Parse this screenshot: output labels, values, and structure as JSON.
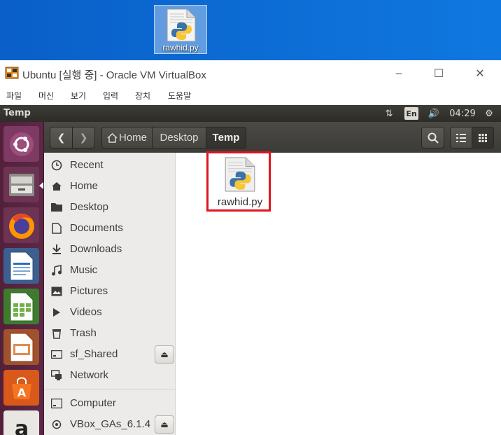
{
  "desktop": {
    "file_label": "rawhid.py",
    "file_icon": "python-file-icon"
  },
  "vbox": {
    "title": "Ubuntu [실행 중] - Oracle VM VirtualBox",
    "menu": [
      "파일",
      "머신",
      "보기",
      "입력",
      "장치",
      "도움말"
    ],
    "controls": {
      "minimize": "‒",
      "maximize": "☐",
      "close": "✕"
    }
  },
  "panel": {
    "title": "Temp",
    "lang": "En",
    "time": "04:29"
  },
  "launcher": [
    "ubuntu-dash-icon",
    "files-icon",
    "firefox-icon",
    "writer-icon",
    "calc-icon",
    "impress-icon",
    "software-center-icon",
    "amazon-icon"
  ],
  "toolbar": {
    "breadcrumbs": [
      {
        "label": "Home"
      },
      {
        "label": "Desktop"
      },
      {
        "label": "Temp"
      }
    ]
  },
  "sidebar": {
    "items": [
      {
        "label": "Recent",
        "icon": "clock-icon"
      },
      {
        "label": "Home",
        "icon": "home-icon"
      },
      {
        "label": "Desktop",
        "icon": "folder-icon"
      },
      {
        "label": "Documents",
        "icon": "document-icon"
      },
      {
        "label": "Downloads",
        "icon": "download-icon"
      },
      {
        "label": "Music",
        "icon": "music-icon"
      },
      {
        "label": "Pictures",
        "icon": "picture-icon"
      },
      {
        "label": "Videos",
        "icon": "video-icon"
      },
      {
        "label": "Trash",
        "icon": "trash-icon"
      },
      {
        "label": "sf_Shared",
        "icon": "drive-icon"
      },
      {
        "label": "Network",
        "icon": "network-icon"
      },
      {
        "label": "Computer",
        "icon": "computer-icon"
      },
      {
        "label": "VBox_GAs_6.1.4",
        "icon": "disc-icon"
      }
    ]
  },
  "files": [
    {
      "name": "rawhid.py",
      "icon": "python-file-icon"
    }
  ],
  "colors": {
    "selection": "#e0141e",
    "panel": "#3c3b37",
    "launcher": "#5c2846"
  }
}
